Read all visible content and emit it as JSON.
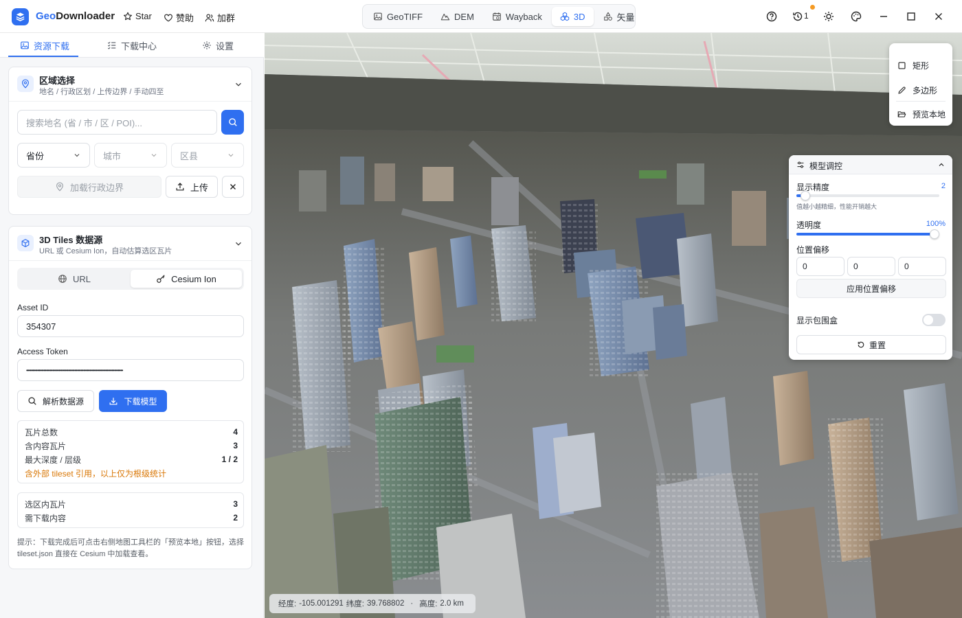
{
  "app": {
    "name_part1": "Geo",
    "name_part2": "Downloader",
    "links": {
      "star": "Star",
      "sponsor": "赞助",
      "group": "加群"
    },
    "history_count": "1",
    "accent_color": "#2f6ff0"
  },
  "mode_tabs": [
    {
      "label": "GeoTIFF",
      "icon": "image-icon"
    },
    {
      "label": "DEM",
      "icon": "mountain-icon"
    },
    {
      "label": "Wayback",
      "icon": "calendar-icon"
    },
    {
      "label": "3D",
      "icon": "cube-cluster-icon",
      "active": true
    },
    {
      "label": "矢量",
      "icon": "shapes-icon"
    }
  ],
  "sidebar": {
    "tabs": [
      {
        "label": "资源下载",
        "active": true
      },
      {
        "label": "下载中心"
      },
      {
        "label": "设置"
      }
    ],
    "region": {
      "title": "区域选择",
      "subtitle": "地名 / 行政区划 / 上传边界 / 手动四至",
      "search_placeholder": "搜索地名 (省 / 市 / 区 / POI)...",
      "province": "省份",
      "city": "城市",
      "district": "区县",
      "load_boundary": "加载行政边界",
      "upload": "上传"
    },
    "tiles": {
      "title": "3D Tiles 数据源",
      "subtitle": "URL 或 Cesium Ion，自动估算选区瓦片",
      "seg_url": "URL",
      "seg_ion": "Cesium Ion",
      "asset_id_label": "Asset ID",
      "asset_id": "354307",
      "token_label": "Access Token",
      "token_masked": "••••••••••••••••••••••••••••••••••••••••••••••••••••••••••••••••••••••••••••••",
      "parse_btn": "解析数据源",
      "download_btn": "下载模型",
      "stats": [
        {
          "label": "瓦片总数",
          "value": "4"
        },
        {
          "label": "含内容瓦片",
          "value": "3"
        },
        {
          "label": "最大深度 / 层级",
          "value": "1 / 2"
        }
      ],
      "warning": "含外部 tileset 引用，以上仅为根级统计",
      "selection": [
        {
          "label": "选区内瓦片",
          "value": "3"
        },
        {
          "label": "需下载内容",
          "value": "2"
        }
      ],
      "hint": "提示：下载完成后可点击右侧地图工具栏的「预览本地」按钮，选择 tileset.json 直接在 Cesium 中加载查看。"
    }
  },
  "map": {
    "draw_tools": {
      "rect": "矩形",
      "polygon": "多边形",
      "preview": "预览本地"
    },
    "model_panel": {
      "title": "模型调控",
      "precision_label": "显示精度",
      "precision_value": "2",
      "precision_note": "值越小越精细，性能开销越大",
      "precision_fraction": 0.03,
      "opacity_label": "透明度",
      "opacity_value": "100%",
      "opacity_fraction": 1.0,
      "offset_label": "位置偏移",
      "offset": [
        "0",
        "0",
        "0"
      ],
      "apply_offset": "应用位置偏移",
      "bbox_label": "显示包围盒",
      "bbox_on": false,
      "reset": "重置"
    },
    "coords": {
      "lon_label": "经度:",
      "lon": "-105.001291",
      "lat_label": "纬度:",
      "lat": "39.768802",
      "sep": "·",
      "alt_label": "高度:",
      "alt": "2.0 km"
    }
  }
}
